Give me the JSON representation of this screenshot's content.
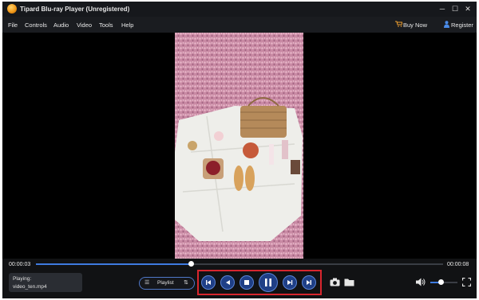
{
  "window": {
    "title": "Tipard Blu-ray Player (Unregistered)"
  },
  "window_controls": {
    "minimize": "─",
    "maximize": "☐",
    "close": "✕"
  },
  "menu": {
    "items": [
      "File",
      "Controls",
      "Audio",
      "Video",
      "Tools",
      "Help"
    ],
    "buy_now": "Buy Now",
    "register": "Register"
  },
  "playback": {
    "current_time": "00:00:03",
    "total_time": "00:00:08",
    "progress": 0.38,
    "volume": 0.38
  },
  "now_playing": {
    "label": "Playing:",
    "filename": "video_ten.mp4"
  },
  "playlist": {
    "label": "Playlist"
  },
  "controls": [
    "previous-icon",
    "rewind-icon",
    "stop-icon",
    "pause-icon",
    "fast-forward-icon",
    "next-icon"
  ],
  "colors": {
    "accent": "#3e7be0",
    "highlight": "#d8262e",
    "button": "#1f3f86"
  }
}
